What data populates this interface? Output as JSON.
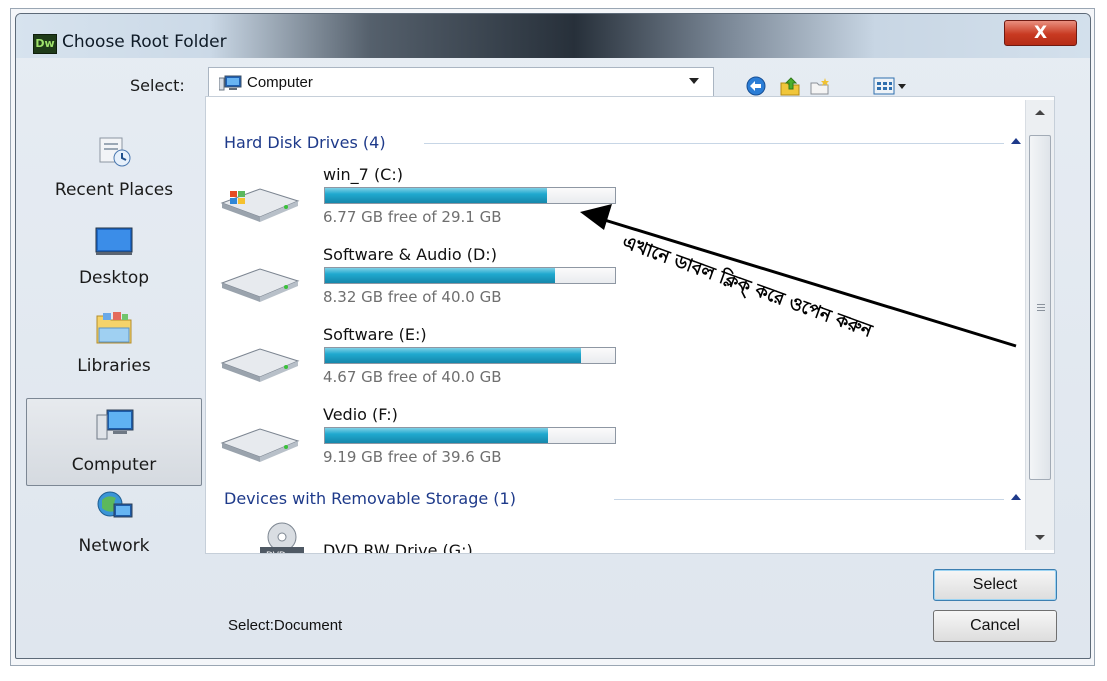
{
  "window": {
    "title": "Choose Root Folder",
    "app_icon_text": "Dw",
    "close_symbol": "X"
  },
  "toolbar": {
    "select_label": "Select:",
    "location_value": "Computer",
    "icons": [
      "back-icon",
      "up-folder-icon",
      "new-folder-icon",
      "view-menu-icon"
    ]
  },
  "sidebar": {
    "items": [
      {
        "label": "Recent Places",
        "icon": "recent-places-icon"
      },
      {
        "label": "Desktop",
        "icon": "desktop-icon"
      },
      {
        "label": "Libraries",
        "icon": "libraries-icon"
      },
      {
        "label": "Computer",
        "icon": "computer-icon",
        "selected": true
      },
      {
        "label": "Network",
        "icon": "network-icon"
      }
    ]
  },
  "content": {
    "groups": [
      {
        "header": "Hard Disk Drives (4)"
      },
      {
        "header": "Devices with Removable Storage (1)"
      }
    ],
    "drives": [
      {
        "name": "win_7 (C:)",
        "free_text": "6.77 GB free of 29.1 GB",
        "used_fraction": 0.767
      },
      {
        "name": "Software & Audio (D:)",
        "free_text": "8.32 GB free of 40.0 GB",
        "used_fraction": 0.792
      },
      {
        "name": "Software (E:)",
        "free_text": "4.67 GB free of 40.0 GB",
        "used_fraction": 0.883
      },
      {
        "name": "Vedio (F:)",
        "free_text": "9.19 GB free of 39.6 GB",
        "used_fraction": 0.768
      }
    ],
    "removable": [
      {
        "name": "DVD RW Drive (G:)",
        "icon": "dvd-drive-icon"
      }
    ]
  },
  "annotation": {
    "text": "এখানে ডাবল ক্লিক্ করে ওপেন করুন"
  },
  "footer": {
    "status": "Select:Document",
    "select_button": "Select",
    "cancel_button": "Cancel"
  },
  "colors": {
    "group_header": "#1e3a8a",
    "capacity_bar": "#20a9cf",
    "close_button": "#c83a22"
  }
}
